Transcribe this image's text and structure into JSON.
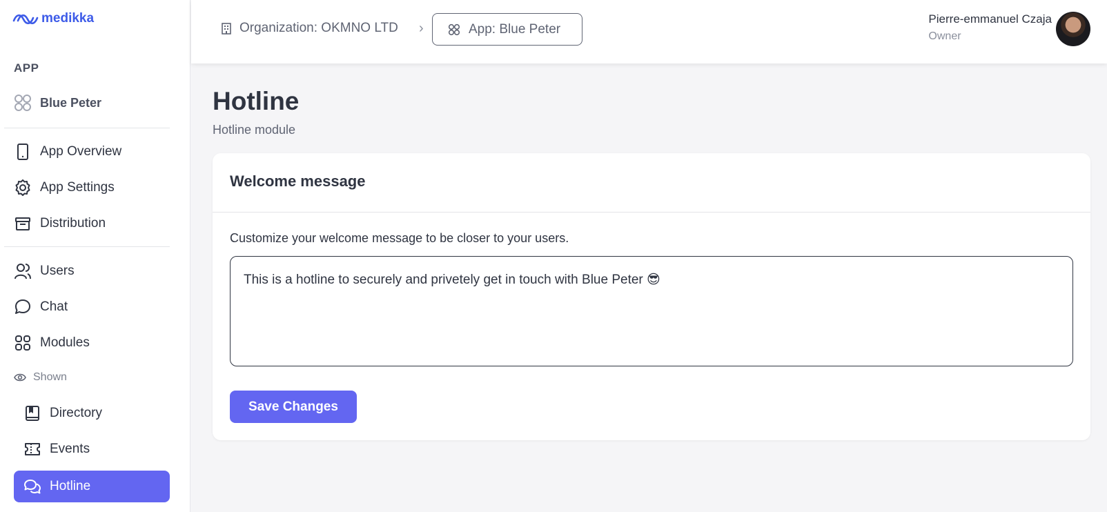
{
  "brand": {
    "name": "medikka",
    "color": "#3d5be8"
  },
  "sidebar": {
    "section_label": "APP",
    "app_name": "Blue Peter",
    "items": [
      {
        "label": "App Overview",
        "icon": "tablet-icon"
      },
      {
        "label": "App Settings",
        "icon": "gear-icon"
      },
      {
        "label": "Distribution",
        "icon": "store-icon"
      },
      {
        "label": "Users",
        "icon": "users-icon"
      },
      {
        "label": "Chat",
        "icon": "chat-bubble-icon"
      },
      {
        "label": "Modules",
        "icon": "grid-icon"
      }
    ],
    "shown_label": "Shown",
    "sub_items": [
      {
        "label": "Directory",
        "icon": "book-icon"
      },
      {
        "label": "Events",
        "icon": "ticket-icon"
      },
      {
        "label": "Hotline",
        "icon": "chat-bubbles-icon",
        "active": true
      }
    ],
    "active_color": "#6366f1"
  },
  "header": {
    "org_crumb": "Organization: OKMNO LTD",
    "separator": "›",
    "app_crumb": "App: Blue Peter",
    "user_name": "Pierre-emmanuel Czaja",
    "user_role": "Owner"
  },
  "main": {
    "title": "Hotline",
    "subtitle": "Hotline module",
    "card": {
      "title": "Welcome message",
      "field_label": "Customize your welcome message to be closer to your users.",
      "message": "This is a hotline to securely and privetely get in touch with Blue Peter 😎",
      "save_label": "Save Changes"
    }
  }
}
